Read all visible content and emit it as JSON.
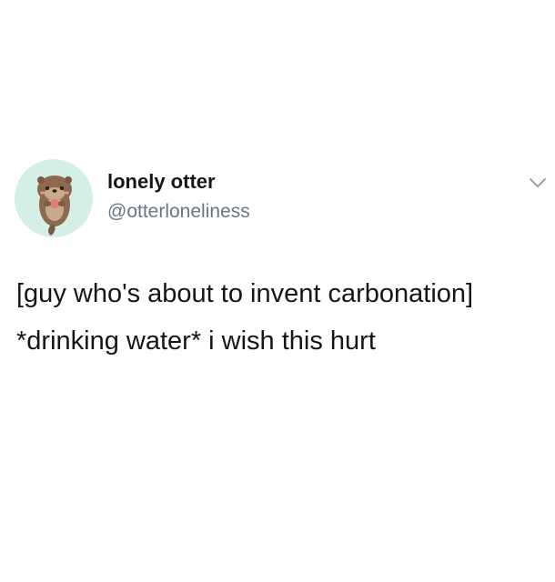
{
  "author": {
    "display_name": "lonely otter",
    "handle": "@otterloneliness",
    "avatar_icon": "otter-avatar-icon",
    "avatar_bg": "#d3efe6"
  },
  "menu": {
    "icon": "chevron-down-icon"
  },
  "tweet": {
    "line1": "[guy who's about to invent carbonation]",
    "line2": "*drinking water* i wish this hurt"
  },
  "colors": {
    "text": "#14171a",
    "secondary": "#657786",
    "background": "#ffffff"
  }
}
